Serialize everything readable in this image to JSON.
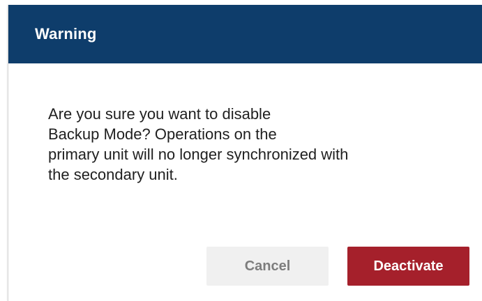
{
  "dialog": {
    "title": "Warning",
    "message_lines": [
      "Are you sure you want to disable",
      "Backup Mode? Operations on the",
      "primary unit will no longer synchronized with",
      "the secondary unit."
    ],
    "buttons": {
      "cancel_label": "Cancel",
      "deactivate_label": "Deactivate"
    },
    "colors": {
      "header": "#0e3d6b",
      "danger": "#a5202b",
      "cancel_bg": "#f0f0f0"
    }
  }
}
